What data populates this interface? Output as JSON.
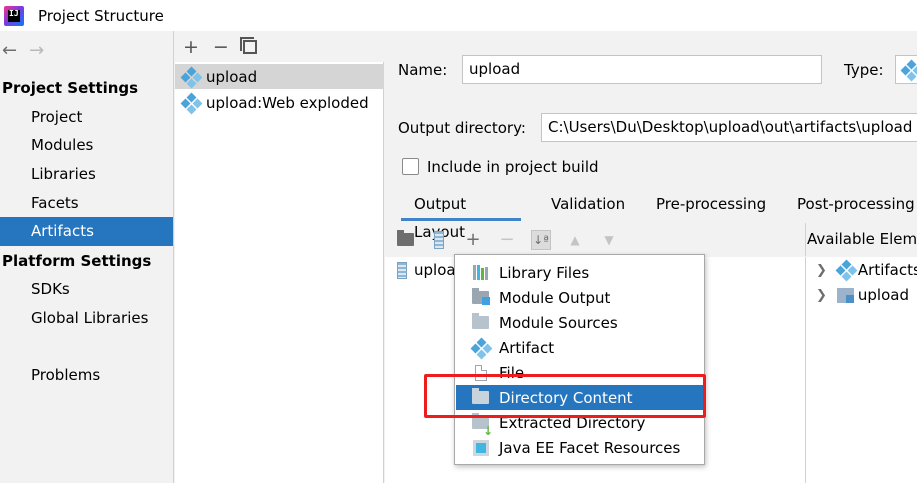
{
  "window": {
    "title": "Project Structure",
    "app_icon_text": "IJ"
  },
  "navigation": {
    "back": "←",
    "forward": "→"
  },
  "sidebar": {
    "project_settings_header": "Project Settings",
    "project_settings": [
      {
        "label": "Project"
      },
      {
        "label": "Modules"
      },
      {
        "label": "Libraries"
      },
      {
        "label": "Facets"
      },
      {
        "label": "Artifacts",
        "selected": true
      }
    ],
    "platform_settings_header": "Platform Settings",
    "platform_settings": [
      {
        "label": "SDKs"
      },
      {
        "label": "Global Libraries"
      }
    ],
    "problems": "Problems"
  },
  "artifacts_list": {
    "toolbar": {
      "add": "+",
      "remove": "−",
      "copy": "copy"
    },
    "items": [
      {
        "label": "upload",
        "selected": true
      },
      {
        "label": "upload:Web exploded",
        "selected": false
      }
    ]
  },
  "artifact_editor": {
    "name_label": "Name:",
    "name_value": "upload",
    "type_label": "Type:",
    "output_dir_label": "Output directory:",
    "output_dir_value": "C:\\Users\\Du\\Desktop\\upload\\out\\artifacts\\upload",
    "include_in_build_label": "Include in project build",
    "include_in_build_checked": false,
    "tabs": [
      {
        "label": "Output Layout",
        "active": true
      },
      {
        "label": "Validation"
      },
      {
        "label": "Pre-processing"
      },
      {
        "label": "Post-processing"
      }
    ],
    "layout_toolbar": {
      "add": "+",
      "remove": "−",
      "sort": "↓ª",
      "up": "▲",
      "down": "▼"
    },
    "layout_tree_root": "uploa",
    "available_elements_header": "Available Elements",
    "available_elements": [
      {
        "label": "Artifacts"
      },
      {
        "label": "upload"
      }
    ]
  },
  "add_menu": {
    "items": [
      {
        "label": "Library Files",
        "icon": "library-icon"
      },
      {
        "label": "Module Output",
        "icon": "module-output-icon"
      },
      {
        "label": "Module Sources",
        "icon": "module-sources-icon"
      },
      {
        "label": "Artifact",
        "icon": "artifact-icon"
      },
      {
        "label": "File",
        "icon": "file-icon"
      },
      {
        "label": "Directory Content",
        "icon": "directory-icon",
        "highlighted": true
      },
      {
        "label": "Extracted Directory",
        "icon": "extracted-directory-icon"
      },
      {
        "label": "Java EE Facet Resources",
        "icon": "javaee-icon"
      }
    ]
  },
  "colors": {
    "selection": "#2675bf",
    "annotation": "#ee1d1d",
    "tab_underline": "#4083c9"
  }
}
